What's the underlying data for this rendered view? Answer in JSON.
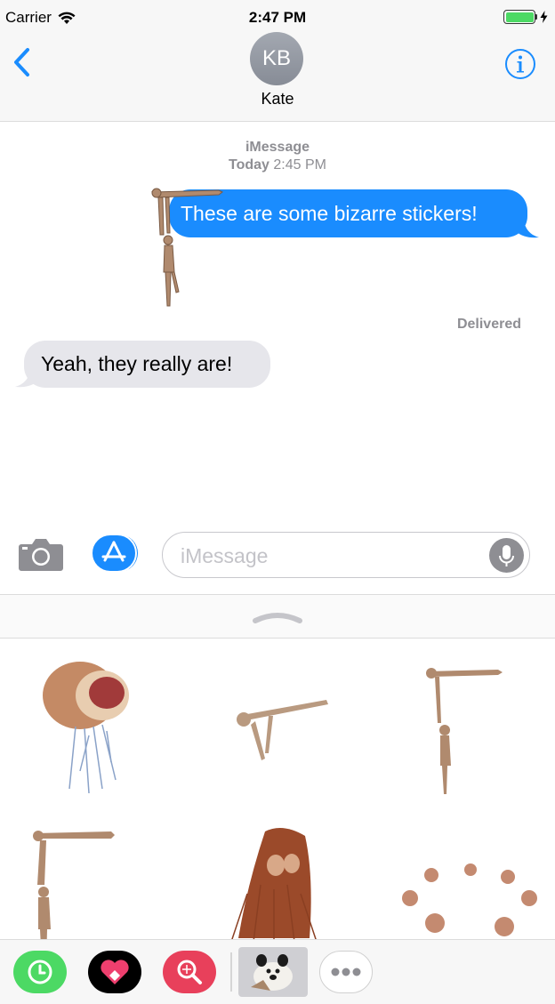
{
  "status": {
    "carrier": "Carrier",
    "time": "2:47 PM"
  },
  "nav": {
    "avatar_initials": "KB",
    "contact_name": "Kate"
  },
  "conversation": {
    "service": "iMessage",
    "day": "Today",
    "time": "2:45 PM",
    "messages": [
      {
        "direction": "outgoing",
        "text": "These are some bizarre stickers!"
      },
      {
        "direction": "incoming",
        "text": "Yeah, they really are!"
      }
    ],
    "delivery_status": "Delivered"
  },
  "composer": {
    "placeholder": "iMessage"
  },
  "colors": {
    "accent": "#1a8cfe",
    "outgoing_bubble": "#1a8cfe",
    "incoming_bubble": "#e6e6eb",
    "battery": "#4cd964"
  },
  "sticker_drawer": {
    "stickers": [
      "cut-head-sticker",
      "floating-figure-sticker",
      "hanging-figures-sticker",
      "stacked-figures-sticker",
      "hair-creature-sticker",
      "heads-circle-sticker"
    ]
  },
  "app_strip": {
    "apps": [
      "recents-icon",
      "heart-app-icon",
      "search-app-icon",
      "sticker-pack-icon",
      "more-icon"
    ],
    "selected": "sticker-pack-icon"
  }
}
